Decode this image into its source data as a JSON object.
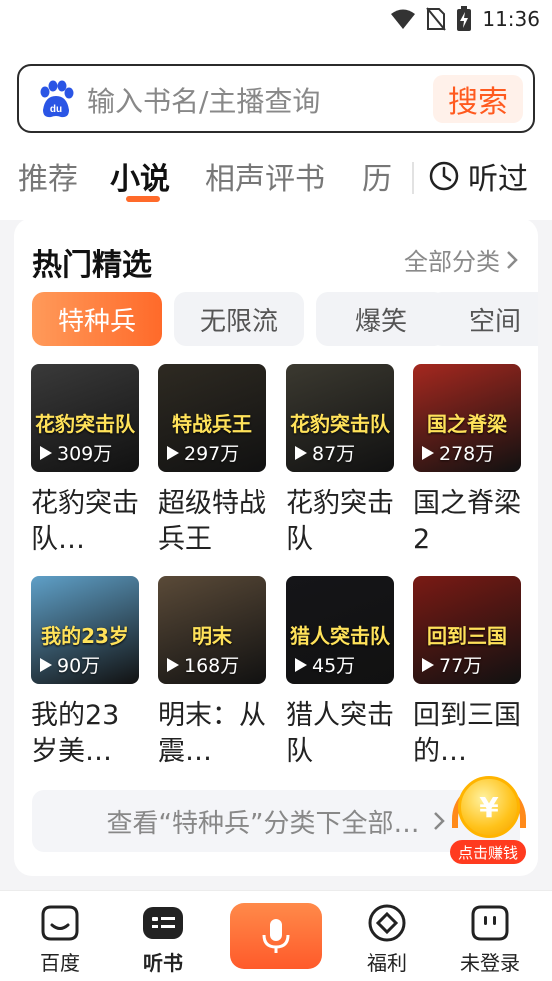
{
  "status_bar": {
    "time": "11:36"
  },
  "search": {
    "placeholder": "输入书名/主播查询",
    "button_label": "搜索"
  },
  "tabs": [
    {
      "label": "推荐",
      "active": false
    },
    {
      "label": "小说",
      "active": true
    },
    {
      "label": "相声评书",
      "active": false
    },
    {
      "label": "历",
      "active": false
    }
  ],
  "history_label": "听过",
  "section": {
    "title": "热门精选",
    "more_label": "全部分类",
    "categories": [
      {
        "label": "特种兵",
        "active": true
      },
      {
        "label": "无限流",
        "active": false
      },
      {
        "label": "爆笑",
        "active": false
      },
      {
        "label": "空间",
        "active": false
      }
    ],
    "books": [
      {
        "title": "花豹突击队…",
        "plays": "309万",
        "cover_text": "花豹突击队",
        "cover_color": "#3a3a3a"
      },
      {
        "title": "超级特战兵王",
        "plays": "297万",
        "cover_text": "特战兵王",
        "cover_color": "#2e2a22"
      },
      {
        "title": "花豹突击队",
        "plays": "87万",
        "cover_text": "花豹突击队",
        "cover_color": "#3b3930"
      },
      {
        "title": "国之脊梁2",
        "plays": "278万",
        "cover_text": "国之脊梁",
        "cover_color": "#a5281f"
      },
      {
        "title": "我的23岁美…",
        "plays": "90万",
        "cover_text": "我的23岁",
        "cover_color": "#5fa0c8"
      },
      {
        "title": "明末：从震…",
        "plays": "168万",
        "cover_text": "明末",
        "cover_color": "#5a4a38"
      },
      {
        "title": "猎人突击队",
        "plays": "45万",
        "cover_text": "猎人突击队",
        "cover_color": "#151518"
      },
      {
        "title": "回到三国的…",
        "plays": "77万",
        "cover_text": "回到三国",
        "cover_color": "#7a1a14"
      }
    ],
    "view_all_label": "查看“特种兵”分类下全部…"
  },
  "earn_badge": {
    "label": "点击赚钱",
    "coin_symbol": "¥"
  },
  "bottom_nav": [
    {
      "label": "百度",
      "icon": "smile-face-icon",
      "active": false
    },
    {
      "label": "听书",
      "icon": "audiobook-icon",
      "active": true
    },
    {
      "label": "福利",
      "icon": "diamond-target-icon",
      "active": false
    },
    {
      "label": "未登录",
      "icon": "user-face-icon",
      "active": false
    }
  ],
  "colors": {
    "accent": "#ff6a2a",
    "brand_blue": "#2a55e5"
  }
}
